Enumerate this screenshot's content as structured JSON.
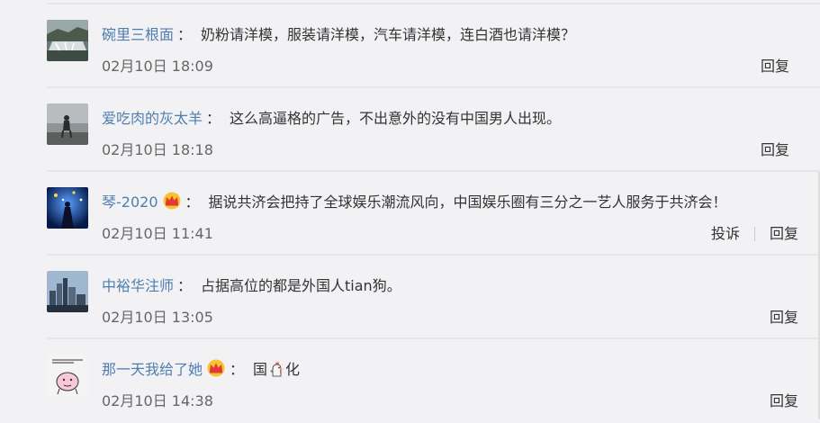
{
  "comments": [
    {
      "user": "碗里三根面",
      "colon": "：",
      "text": "奶粉请洋模，服装请洋模，汽车请洋模，连白酒也请洋模？",
      "time": "02月10日 18:09",
      "actions": [
        "回复"
      ],
      "avatar": "waterfall-landscape",
      "crown": false
    },
    {
      "user": "爱吃肉的灰太羊",
      "colon": "：",
      "text": "这么高逼格的广告，不出意外的没有中国男人出现。",
      "time": "02月10日 18:18",
      "actions": [
        "回复"
      ],
      "avatar": "person-by-sea",
      "crown": false
    },
    {
      "user": "琴-2020",
      "colon": "：",
      "text": "据说共济会把持了全球娱乐潮流风向，中国娱乐圈有三分之一艺人服务于共济会！",
      "time": "02月10日 11:41",
      "actions": [
        "投诉",
        "回复"
      ],
      "avatar": "night-sky-figure",
      "crown": true
    },
    {
      "user": "中裕华注师",
      "colon": "：",
      "text": "占据高位的都是外国人tian狗。",
      "time": "02月10日 13:05",
      "actions": [
        "回复"
      ],
      "avatar": "city-skyline",
      "crown": false
    },
    {
      "user": "那一天我给了她",
      "colon": "：",
      "text_before": "国",
      "text_after": "化",
      "text_icon": "rooster-emoji",
      "time": "02月10日 14:38",
      "actions": [
        "回复"
      ],
      "avatar": "cartoon-sketch",
      "crown": true
    }
  ],
  "colors": {
    "username": "#507daf",
    "text": "#333333",
    "meta": "#666666",
    "background": "#f2f2f5",
    "divider": "#e6e6e6"
  }
}
